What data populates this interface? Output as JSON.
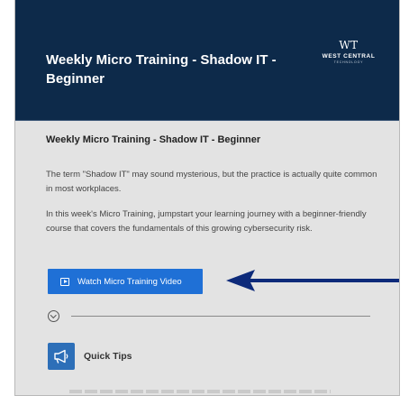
{
  "header": {
    "title": "Weekly Micro Training - Shadow IT - Beginner",
    "logo": {
      "mark": "WT",
      "name": "WEST CENTRAL",
      "sub": "TECHNOLOGY"
    },
    "background": "#0d2a4a"
  },
  "content": {
    "title": "Weekly Micro Training - Shadow IT - Beginner",
    "paragraph_1": "The term \"Shadow IT\" may sound mysterious, but the practice is actually quite common in most workplaces.",
    "paragraph_2": "In this week's Micro Training, jumpstart your learning journey with a beginner-friendly course that covers the fundamentals of this growing cybersecurity risk.",
    "watch_button": {
      "label": "Watch Micro Training Video",
      "icon": "play-icon",
      "color": "#1f70d6"
    },
    "quick_tips": {
      "label": "Quick Tips",
      "icon": "megaphone-icon",
      "color": "#2d6fb8"
    }
  },
  "annotation": {
    "arrow_icon": "arrow-left-icon",
    "color": "#0d2a7a"
  }
}
